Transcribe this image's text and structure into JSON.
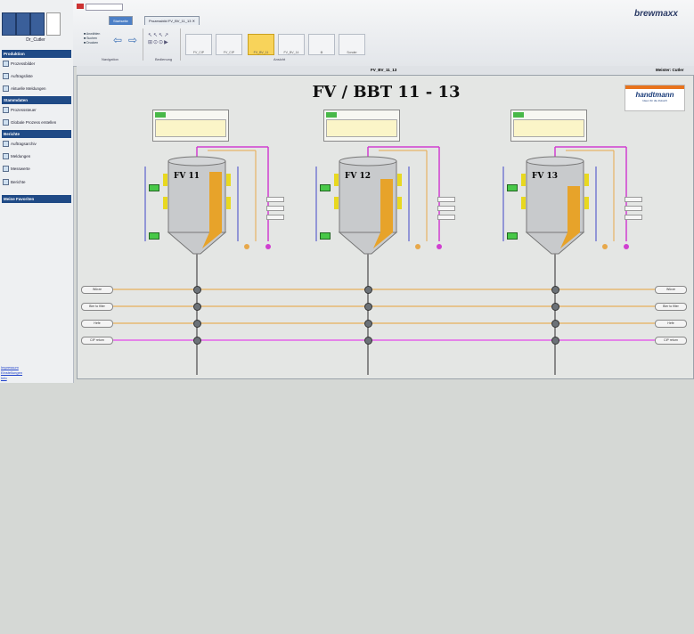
{
  "window": {
    "app_brand": "brewmaxx",
    "tabs": [
      "Prozessbild FV_BV_11_13"
    ]
  },
  "sidebar": {
    "user_label": "Dr_Cutler",
    "sections": [
      {
        "title": "Produktion",
        "items": [
          "Prozessbilder",
          "Auftragsliste",
          "Aktuelle Meldungen"
        ]
      },
      {
        "title": "Stammdaten",
        "items": [
          "Prozesssteuer",
          "Globale Prozess erstellen"
        ]
      },
      {
        "title": "Berichte",
        "items": [
          "Auftragsarchiv",
          "Meldungen",
          "Messwerte",
          "Berichte"
        ]
      },
      {
        "title": "Meine Favoriten",
        "items": []
      }
    ],
    "footer_links": [
      "Impressum",
      "Einstellungen",
      "Info"
    ]
  },
  "ribbon": {
    "groups": [
      {
        "label": "Navigation"
      },
      {
        "label": "Bedienung"
      },
      {
        "label": "Ansicht"
      }
    ]
  },
  "hmi": {
    "screen_id": "FV_BV_11_13",
    "user_status": "Meister: Cutler",
    "title": "FV / BBT 11 - 13",
    "logo_text": "handtmann",
    "logo_tagline": "Ideen für die Zukunft",
    "tanks": [
      {
        "label": "FV 11",
        "level": 0.72
      },
      {
        "label": "FV 12",
        "level": 0.64
      },
      {
        "label": "FV 13",
        "level": 0.56
      }
    ],
    "pipe_labels_left": [
      "Würze",
      "Bier to filter",
      "Hefe",
      "CIP return"
    ],
    "pipe_labels_right": [
      "Würze",
      "Bier to filter",
      "Hefe",
      "CIP return"
    ]
  }
}
